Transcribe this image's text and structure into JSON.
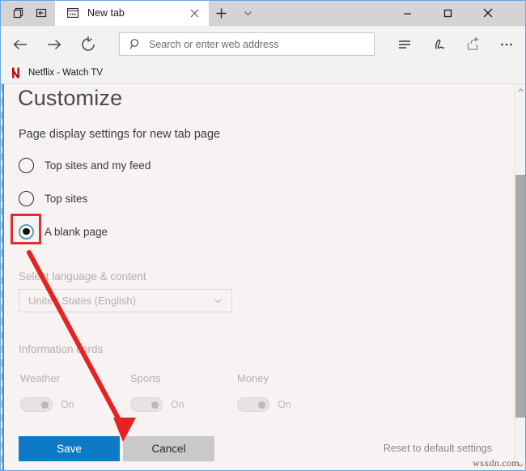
{
  "window": {
    "titlebar": {
      "history_icon": "tab-preview-icon",
      "setaside_icon": "set-tabs-aside-icon",
      "minimize_label": "─",
      "maximize_label": "□",
      "close_label": "✕"
    },
    "tab": {
      "title": "New tab",
      "favicon": "new-tab-icon",
      "close_label": "✕"
    },
    "new_tab_button_label": "+",
    "tab_menu_label": "⌄"
  },
  "toolbar": {
    "back_label": "←",
    "forward_label": "→",
    "refresh_label": "↻",
    "address": {
      "placeholder": "Search or enter web address",
      "value": "",
      "search_icon": "search-icon"
    },
    "reading_view_icon": "reading-view-icon",
    "notes_icon": "make-a-web-note-icon",
    "share_icon": "share-icon",
    "more_icon": "more-settings-icon"
  },
  "favorites_bar": {
    "items": [
      {
        "label": "Netflix - Watch TV",
        "icon": "netflix-icon",
        "color": "#d4121a"
      }
    ]
  },
  "customize": {
    "title": "Customize",
    "display_heading": "Page display settings for new tab page",
    "radio_options": [
      {
        "label": "Top sites and my feed",
        "checked": false
      },
      {
        "label": "Top sites",
        "checked": false
      },
      {
        "label": "A blank page",
        "checked": true
      }
    ],
    "language_heading": "Select language & content",
    "language_select": {
      "value": "United States (English)",
      "caret_icon": "chevron-down-icon",
      "disabled": true
    },
    "cards_heading": "Information cards",
    "cards": [
      {
        "title": "Weather",
        "state_label": "On",
        "enabled": false
      },
      {
        "title": "Sports",
        "state_label": "On",
        "enabled": false
      },
      {
        "title": "Money",
        "state_label": "On",
        "enabled": false
      }
    ],
    "save_label": "Save",
    "cancel_label": "Cancel",
    "reset_label": "Reset to default settings",
    "save_color": "#0c7ac4"
  },
  "scrollbar": {
    "up_arrow": "⌃",
    "down_arrow": "⌄"
  },
  "annotation": {
    "highlight_color": "#e03030",
    "arrow_color": "#e62222",
    "target": "a-blank-page-radio",
    "points_to": "save-button"
  },
  "watermark": {
    "text": "wsxdn.com"
  }
}
